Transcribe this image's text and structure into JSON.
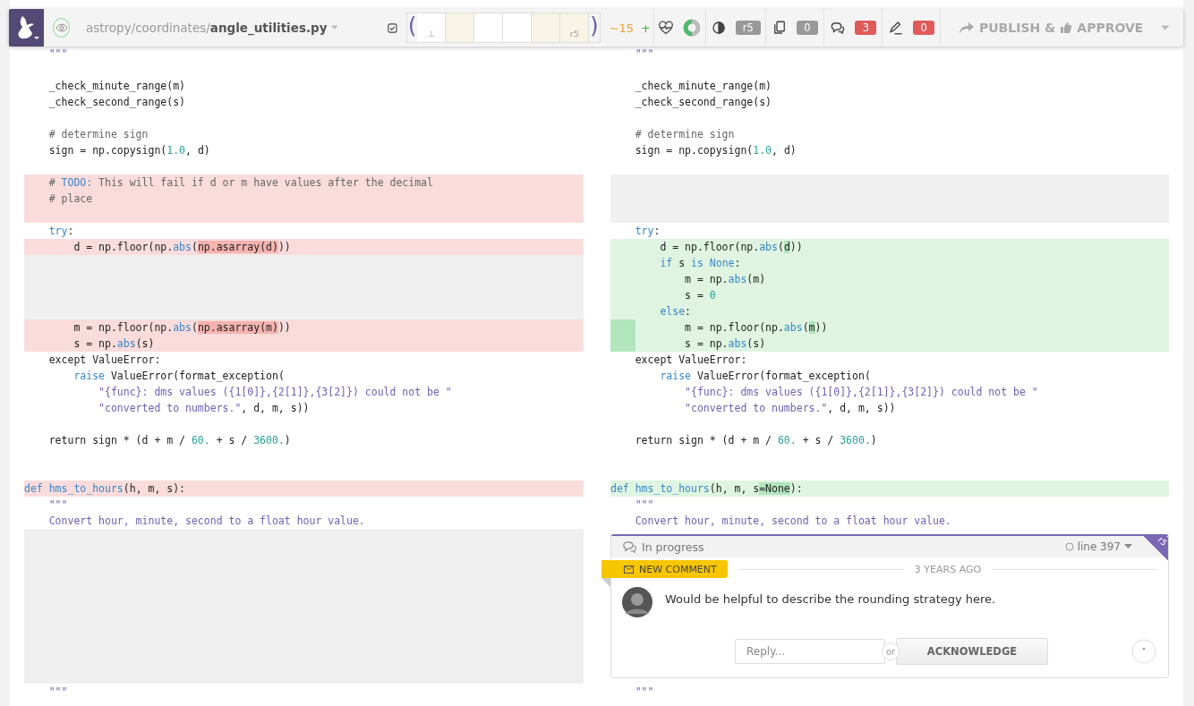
{
  "toolbar": {
    "path": "astropy/coordinates/**angle_utilities.py**",
    "revision_strip": {
      "open": "(",
      "close": ")",
      "cells": [
        {
          "label": "⊥",
          "color": "#ffffff"
        },
        {
          "color": "#f8f3e4"
        },
        {
          "color": "#ffffff"
        },
        {
          "color": "#ffffff"
        },
        {
          "color": "#f8f3e4"
        },
        {
          "label": "r5",
          "color": "#f8f3e4"
        }
      ]
    },
    "changes": "~15",
    "additions": "+",
    "counters": [
      {
        "kind": "contrast",
        "count": "r5",
        "color": "#999999"
      },
      {
        "kind": "copy",
        "count": "0",
        "color": "#999999"
      },
      {
        "kind": "comments",
        "count": "3",
        "color": "#e05a5a"
      },
      {
        "kind": "pen",
        "count": "0",
        "color": "#e05a5a"
      }
    ],
    "publish": {
      "label": "PUBLISH &",
      "label_2": "APPROVE",
      "disabled": true
    }
  },
  "left_pane": {
    "lines": [
      {
        "kind": "plain",
        "tokens": [
          {
            "kind": "str",
            "s": "    \"\"\""
          }
        ]
      },
      {
        "kind": "plain"
      },
      {
        "kind": "plain",
        "tokens": [
          {
            "kind": "t",
            "s": "    _check_minute_range(m)"
          }
        ]
      },
      {
        "kind": "plain",
        "tokens": [
          {
            "kind": "t",
            "s": "    _check_second_range(s)"
          }
        ]
      },
      {
        "kind": "plain"
      },
      {
        "kind": "plain",
        "tokens": [
          {
            "kind": "com",
            "s": "    # determine sign"
          }
        ]
      },
      {
        "kind": "plain",
        "tokens": [
          {
            "kind": "t",
            "s": "    sign = np.copysign("
          },
          {
            "kind": "num",
            "s": "1.0"
          },
          {
            "kind": "t",
            "s": ", d)"
          }
        ]
      },
      {
        "kind": "plain"
      },
      {
        "kind": "del",
        "tokens": [
          {
            "kind": "com",
            "s": "    # "
          },
          {
            "kind": "todo",
            "s": "TODO:"
          },
          {
            "kind": "com",
            "s": " This will fail if d or m have values after the decimal"
          }
        ]
      },
      {
        "kind": "del",
        "tokens": [
          {
            "kind": "com",
            "s": "    # place"
          }
        ]
      },
      {
        "kind": "del"
      },
      {
        "kind": "plain",
        "tokens": [
          {
            "kind": "kw",
            "s": "    try"
          },
          {
            "kind": "t",
            "s": ":"
          }
        ]
      },
      {
        "kind": "del",
        "tokens": [
          {
            "kind": "t",
            "s": "        d = np.floor(np."
          },
          {
            "kind": "kw",
            "s": "abs"
          },
          {
            "kind": "t",
            "s": "("
          },
          {
            "kind": "hl",
            "s": "np.asarray(d)"
          },
          {
            "kind": "t",
            "s": "))"
          }
        ]
      },
      {
        "kind": "filler"
      },
      {
        "kind": "filler"
      },
      {
        "kind": "filler"
      },
      {
        "kind": "filler"
      },
      {
        "kind": "del",
        "tokens": [
          {
            "kind": "t",
            "s": "        m = np.floor(np."
          },
          {
            "kind": "kw",
            "s": "abs"
          },
          {
            "kind": "t",
            "s": "("
          },
          {
            "kind": "hl",
            "s": "np.asarray(m)"
          },
          {
            "kind": "t",
            "s": "))"
          }
        ]
      },
      {
        "kind": "del",
        "tokens": [
          {
            "kind": "t",
            "s": "        s = np."
          },
          {
            "kind": "kw",
            "s": "abs"
          },
          {
            "kind": "t",
            "s": "(s)"
          }
        ]
      },
      {
        "kind": "plain",
        "tokens": [
          {
            "kind": "t",
            "s": "    except ValueError:"
          }
        ]
      },
      {
        "kind": "plain",
        "tokens": [
          {
            "kind": "kw",
            "s": "        raise"
          },
          {
            "kind": "t",
            "s": " ValueError(format_exception("
          }
        ]
      },
      {
        "kind": "plain",
        "tokens": [
          {
            "kind": "str",
            "s": "            \"{func}: dms values ({1[0]},{2[1]},{3[2]}) could not be \""
          }
        ]
      },
      {
        "kind": "plain",
        "tokens": [
          {
            "kind": "str",
            "s": "            \"converted to numbers.\""
          },
          {
            "kind": "t",
            "s": ", d, m, s))"
          }
        ]
      },
      {
        "kind": "plain"
      },
      {
        "kind": "plain",
        "tokens": [
          {
            "kind": "t",
            "s": "    return sign * (d + m / "
          },
          {
            "kind": "num",
            "s": "60."
          },
          {
            "kind": "t",
            "s": " + s / "
          },
          {
            "kind": "num",
            "s": "3600."
          },
          {
            "kind": "t",
            "s": ")"
          }
        ]
      },
      {
        "kind": "plain"
      },
      {
        "kind": "plain"
      },
      {
        "kind": "del",
        "tokens": [
          {
            "kind": "kw",
            "s": "def hms_to_hours"
          },
          {
            "kind": "t",
            "s": "(h, m, s):"
          }
        ]
      },
      {
        "kind": "plain",
        "tokens": [
          {
            "kind": "str",
            "s": "    \"\"\""
          }
        ]
      },
      {
        "kind": "plain",
        "tokens": [
          {
            "kind": "str",
            "s": "    Convert hour, minute, second to a float hour value."
          }
        ]
      },
      {
        "kind": "gap"
      },
      {
        "kind": "plain",
        "tokens": [
          {
            "kind": "str",
            "s": "    \"\"\""
          }
        ]
      }
    ]
  },
  "right_pane": {
    "lines": [
      {
        "kind": "plain",
        "tokens": [
          {
            "kind": "str",
            "s": "    \"\"\""
          }
        ]
      },
      {
        "kind": "plain"
      },
      {
        "kind": "plain",
        "tokens": [
          {
            "kind": "t",
            "s": "    _check_minute_range(m)"
          }
        ]
      },
      {
        "kind": "plain",
        "tokens": [
          {
            "kind": "t",
            "s": "    _check_second_range(s)"
          }
        ]
      },
      {
        "kind": "plain"
      },
      {
        "kind": "plain",
        "tokens": [
          {
            "kind": "com",
            "s": "    # determine sign"
          }
        ]
      },
      {
        "kind": "plain",
        "tokens": [
          {
            "kind": "t",
            "s": "    sign = np.copysign("
          },
          {
            "kind": "num",
            "s": "1.0"
          },
          {
            "kind": "t",
            "s": ", d)"
          }
        ]
      },
      {
        "kind": "plain"
      },
      {
        "kind": "filler"
      },
      {
        "kind": "filler"
      },
      {
        "kind": "filler"
      },
      {
        "kind": "plain",
        "tokens": [
          {
            "kind": "kw",
            "s": "    try"
          },
          {
            "kind": "t",
            "s": ":"
          }
        ]
      },
      {
        "kind": "add",
        "tokens": [
          {
            "kind": "t",
            "s": "        d = np.floor(np."
          },
          {
            "kind": "kw",
            "s": "abs"
          },
          {
            "kind": "t",
            "s": "("
          },
          {
            "kind": "hl",
            "s": "d"
          },
          {
            "kind": "t",
            "s": "))"
          }
        ]
      },
      {
        "kind": "add",
        "tokens": [
          {
            "kind": "kw",
            "s": "        if"
          },
          {
            "kind": "t",
            "s": " s "
          },
          {
            "kind": "kw",
            "s": "is None"
          },
          {
            "kind": "t",
            "s": ":"
          }
        ]
      },
      {
        "kind": "add",
        "tokens": [
          {
            "kind": "t",
            "s": "            m = np."
          },
          {
            "kind": "kw",
            "s": "abs"
          },
          {
            "kind": "t",
            "s": "(m)"
          }
        ]
      },
      {
        "kind": "add",
        "tokens": [
          {
            "kind": "t",
            "s": "            s = "
          },
          {
            "kind": "num",
            "s": "0"
          }
        ]
      },
      {
        "kind": "add",
        "tokens": [
          {
            "kind": "kw",
            "s": "        else"
          },
          {
            "kind": "t",
            "s": ":"
          }
        ]
      },
      {
        "kind": "add",
        "indent_marked": true,
        "tokens": [
          {
            "kind": "t",
            "s": "        m = np.floor(np."
          },
          {
            "kind": "kw",
            "s": "abs"
          },
          {
            "kind": "t",
            "s": "("
          },
          {
            "kind": "hl",
            "s": "m"
          },
          {
            "kind": "t",
            "s": "))"
          }
        ]
      },
      {
        "kind": "add",
        "indent_marked": true,
        "tokens": [
          {
            "kind": "t",
            "s": "        s = np."
          },
          {
            "kind": "kw",
            "s": "abs"
          },
          {
            "kind": "t",
            "s": "(s)"
          }
        ]
      },
      {
        "kind": "plain",
        "tokens": [
          {
            "kind": "t",
            "s": "    except ValueError:"
          }
        ]
      },
      {
        "kind": "plain",
        "tokens": [
          {
            "kind": "kw",
            "s": "        raise"
          },
          {
            "kind": "t",
            "s": " ValueError(format_exception("
          }
        ]
      },
      {
        "kind": "plain",
        "tokens": [
          {
            "kind": "str",
            "s": "            \"{func}: dms values ({1[0]},{2[1]},{3[2]}) could not be \""
          }
        ]
      },
      {
        "kind": "plain",
        "tokens": [
          {
            "kind": "str",
            "s": "            \"converted to numbers.\""
          },
          {
            "kind": "t",
            "s": ", d, m, s))"
          }
        ]
      },
      {
        "kind": "plain"
      },
      {
        "kind": "plain",
        "tokens": [
          {
            "kind": "t",
            "s": "    return sign * (d + m / "
          },
          {
            "kind": "num",
            "s": "60."
          },
          {
            "kind": "t",
            "s": " + s / "
          },
          {
            "kind": "num",
            "s": "3600."
          },
          {
            "kind": "t",
            "s": ")"
          }
        ]
      },
      {
        "kind": "plain"
      },
      {
        "kind": "plain"
      },
      {
        "kind": "add",
        "tokens": [
          {
            "kind": "kw",
            "s": "def hms_to_hours"
          },
          {
            "kind": "t",
            "s": "(h, m, s"
          },
          {
            "kind": "hl",
            "s": "=None"
          },
          {
            "kind": "t",
            "s": "):"
          }
        ]
      },
      {
        "kind": "plain",
        "tokens": [
          {
            "kind": "str",
            "s": "    \"\"\""
          }
        ]
      },
      {
        "kind": "plain",
        "tokens": [
          {
            "kind": "str",
            "s": "    Convert hour, minute, second to a float hour value."
          }
        ]
      },
      {
        "kind": "comment"
      },
      {
        "kind": "plain",
        "tokens": [
          {
            "kind": "str",
            "s": "    \"\"\""
          }
        ]
      }
    ]
  },
  "comment": {
    "status": "In progress",
    "line": "line 397",
    "revision": "r5",
    "tag": "NEW COMMENT",
    "time": "3 YEARS AGO",
    "text": "Would be helpful to describe the rounding strategy here.",
    "reply_placeholder": "Reply...",
    "or": "or",
    "action": "ACKNOWLEDGE"
  }
}
